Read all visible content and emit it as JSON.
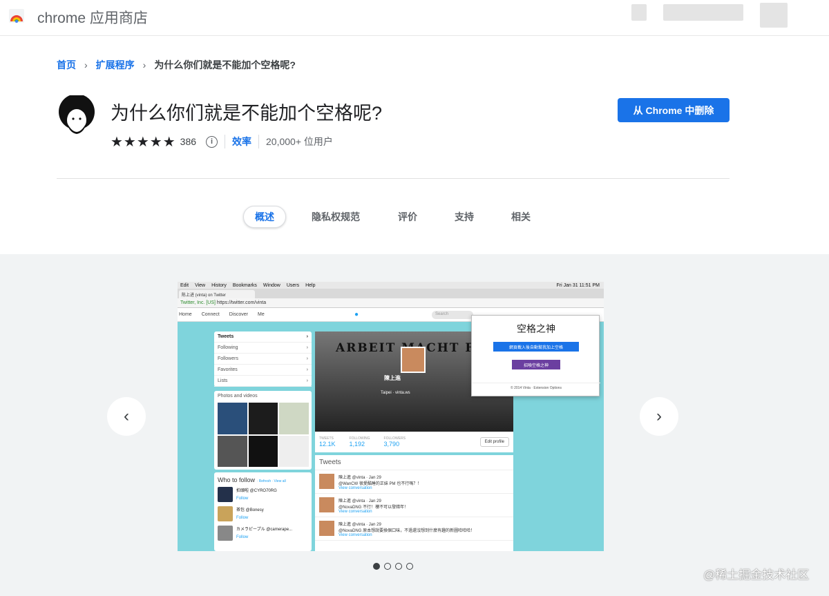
{
  "header": {
    "store_title": "chrome 应用商店"
  },
  "breadcrumb": {
    "home": "首页",
    "extensions": "扩展程序",
    "current": "为什么你们就是不能加个空格呢?"
  },
  "extension": {
    "title": "为什么你们就是不能加个空格呢?",
    "rating_stars": 5,
    "rating_count": "386",
    "info_glyph": "i",
    "category": "效率",
    "users": "20,000+ 位用户",
    "action_label": "从 Chrome 中删除",
    "accent": "#1a73e8"
  },
  "tabs": [
    {
      "label": "概述",
      "active": true
    },
    {
      "label": "隐私权规范",
      "active": false
    },
    {
      "label": "评价",
      "active": false
    },
    {
      "label": "支持",
      "active": false
    },
    {
      "label": "相关",
      "active": false
    }
  ],
  "gallery": {
    "prev_icon": "chevron-left-icon",
    "next_icon": "chevron-right-icon",
    "slide_count": 4,
    "active_slide": 1,
    "screenshot": {
      "menubar": [
        "Edit",
        "View",
        "History",
        "Bookmarks",
        "Window",
        "Users",
        "Help"
      ],
      "menubar_right": "Fri Jan 31  11:51 PM",
      "tab_title": "陈上进 (vinta) on Twitter",
      "url_prefix": "Twitter, Inc. [US]",
      "url": "https://twitter.com/vinta",
      "nav": [
        "Home",
        "Connect",
        "Discover",
        "Me"
      ],
      "search_placeholder": "Search",
      "left_menu": [
        "Tweets",
        "Following",
        "Followers",
        "Favorites",
        "Lists"
      ],
      "photos_label": "Photos and videos",
      "who_to_follow": "Who to follow",
      "wtf_links": "· Refresh · View all",
      "follow_label": "Follow",
      "suggestions": [
        "拍頭啦 @CYRO70RG",
        "茶包 @Bonesy",
        "カメラピープル @camerape..."
      ],
      "cover_text": "ARBEIT MACHT FREI",
      "profile_name": "陳上進",
      "profile_bio": "Taipei · vinta.ws",
      "stats": [
        {
          "label": "TWEETS",
          "value": "12.1K"
        },
        {
          "label": "FOLLOWING",
          "value": "1,192"
        },
        {
          "label": "FOLLOWERS",
          "value": "3,790"
        }
      ],
      "edit_profile": "Edit profile",
      "tweets_heading": "Tweets",
      "tweets": [
        {
          "author": "陳上進 @vinta · Jan 29",
          "text": "@WanCW 很愛酷睡的正妹 PM 也不行嗎？！",
          "link": "View conversation"
        },
        {
          "author": "陳上進 @vinta · Jan 29",
          "text": "@NovaDNG 不行！樓不可以發錯年！",
          "link": "View conversation"
        },
        {
          "author": "陳上進 @vinta · Jan 29",
          "text": "@NovaDNG 原本想說要換個口味，不過還沒想到什麼有趣的新圖哈哈哈！",
          "link": "View conversation"
        }
      ],
      "popup_title": "空格之神",
      "popup_btn1": "網頁載入後自動幫我加上空格",
      "popup_btn2": "招喚空格之神",
      "popup_footer": "© 2014 Vinta · Extension Options"
    }
  },
  "watermark": "@稀土掘金技术社区"
}
